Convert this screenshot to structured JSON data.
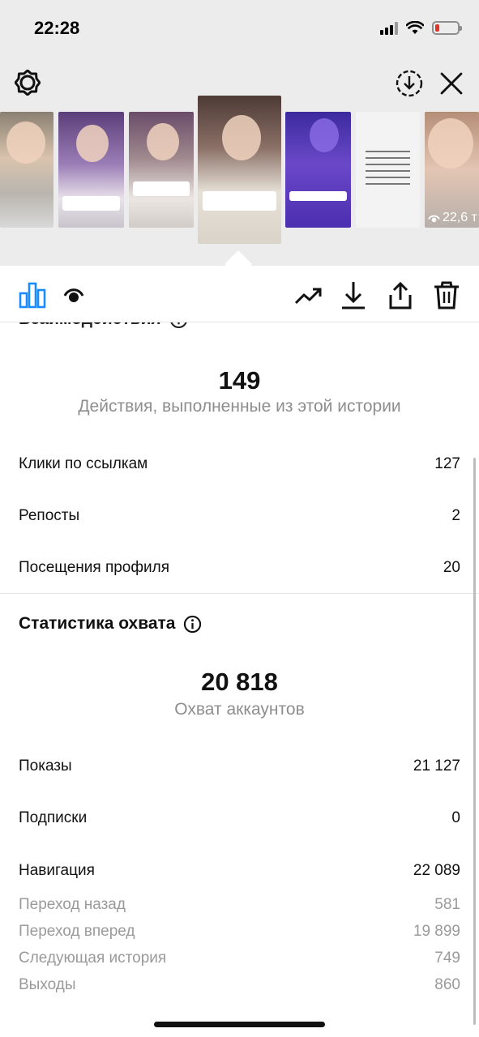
{
  "status_bar": {
    "time": "22:28",
    "icons": [
      "cellular-signal-icon",
      "wifi-icon",
      "battery-low-icon"
    ],
    "battery_color": "#e0342b"
  },
  "header": {
    "icons": [
      "settings-gear-icon",
      "download-circle-icon",
      "close-icon"
    ]
  },
  "thumbnails": {
    "count": 7,
    "selected_index": 3,
    "last_views_label": "22,6 т"
  },
  "toolbar": {
    "icons": [
      "bar-chart-icon",
      "eye-icon",
      "trend-icon",
      "download-icon",
      "share-icon",
      "trash-icon"
    ],
    "active_color": "#1a8cff"
  },
  "interactions": {
    "title": "Взаимодействия",
    "total": "149",
    "caption": "Действия, выполненные из этой истории",
    "rows": [
      {
        "label": "Клики по ссылкам",
        "value": "127"
      },
      {
        "label": "Репосты",
        "value": "2"
      },
      {
        "label": "Посещения профиля",
        "value": "20"
      }
    ]
  },
  "reach": {
    "title": "Статистика охвата",
    "total": "20 818",
    "caption": "Охват аккаунтов",
    "rows": [
      {
        "label": "Показы",
        "value": "21 127"
      },
      {
        "label": "Подписки",
        "value": "0"
      },
      {
        "label": "Навигация",
        "value": "22 089"
      }
    ],
    "sub_rows": [
      {
        "label": "Переход назад",
        "value": "581"
      },
      {
        "label": "Переход вперед",
        "value": "19 899"
      },
      {
        "label": "Следующая история",
        "value": "749"
      },
      {
        "label": "Выходы",
        "value": "860"
      }
    ]
  }
}
